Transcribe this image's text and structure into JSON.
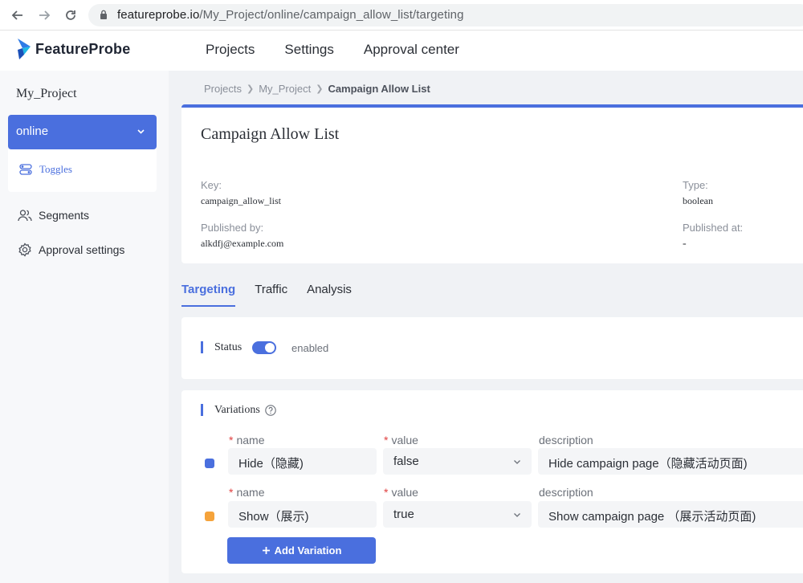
{
  "browser": {
    "url_host": "featureprobe.io",
    "url_path": "/My_Project/online/campaign_allow_list/targeting"
  },
  "header": {
    "logo_text": "FeatureProbe",
    "nav": [
      "Projects",
      "Settings",
      "Approval center"
    ]
  },
  "sidebar": {
    "project_name": "My_Project",
    "environment": "online",
    "toggles_label": "Toggles",
    "segments_label": "Segments",
    "approval_settings_label": "Approval settings"
  },
  "breadcrumb": [
    "Projects",
    "My_Project",
    "Campaign Allow List"
  ],
  "toggle": {
    "title": "Campaign Allow List",
    "key_label": "Key:",
    "key_value": "campaign_allow_list",
    "type_label": "Type:",
    "type_value": "boolean",
    "published_by_label": "Published by:",
    "published_by_value": "alkdfj@example.com",
    "published_at_label": "Published at:",
    "published_at_value": "-"
  },
  "tabs": [
    "Targeting",
    "Traffic",
    "Analysis"
  ],
  "status": {
    "title": "Status",
    "enabled": true,
    "text": "enabled"
  },
  "variations": {
    "title": "Variations",
    "name_label": "name",
    "value_label": "value",
    "description_label": "description",
    "items": [
      {
        "name": "Hide（隐藏)",
        "value": "false",
        "description": "Hide campaign  page（隐藏活动页面)",
        "color": "#4a6fde"
      },
      {
        "name": "Show（展示)",
        "value": "true",
        "description": "Show campaign  page （展示活动页面)",
        "color": "#f5a33b"
      }
    ],
    "add_button": "Add Variation"
  },
  "colors": {
    "accent": "#4a6fde",
    "page_bg": "#f0f2f5"
  }
}
